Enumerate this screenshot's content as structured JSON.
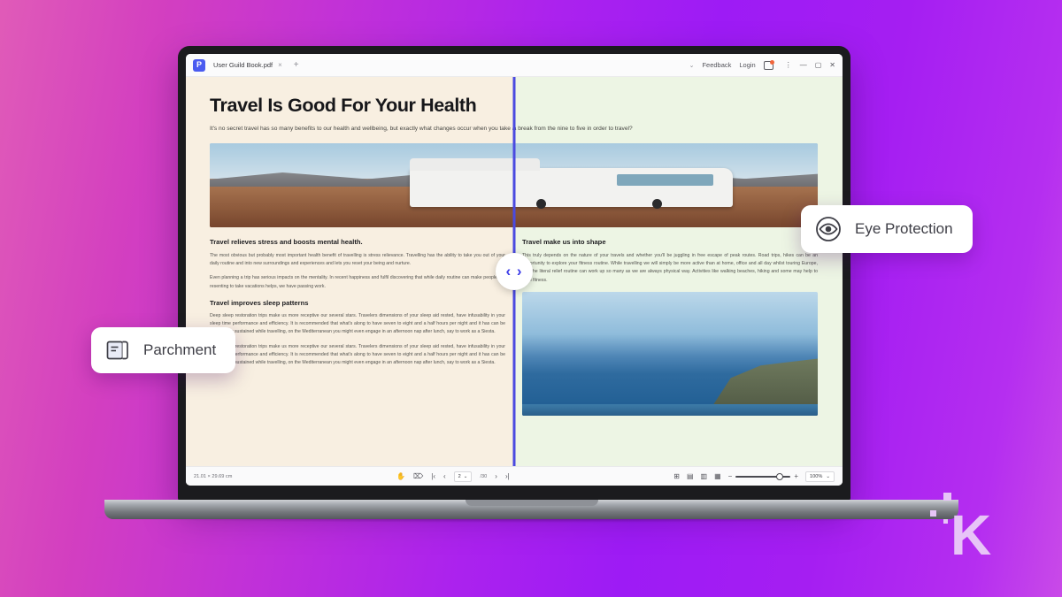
{
  "window": {
    "app_icon": "pdf-app-icon",
    "tab_title": "User Guild Book.pdf",
    "tab_close": "×",
    "new_tab": "+",
    "chevron": "⌄",
    "feedback": "Feedback",
    "login": "Login",
    "notification_icon": "notification-badge-icon",
    "menu_icon": "⋮",
    "minimize": "—",
    "maximize": "▢",
    "close": "✕"
  },
  "document": {
    "title": "Travel Is Good For Your Health",
    "lede": "It's no secret travel has so many benefits to our health and wellbeing, but exactly what changes occur when you take a break from the nine to five in order to travel?",
    "col_left_heading": "Travel relieves stress and boosts mental health.",
    "col_left_body_1": "The most obvious but probably most important health benefit of travelling is stress relievance. Travelling has the ability to take you out of your daily routine and into new surroundings and experiences and lets you reset your being and nurture.",
    "col_left_body_2": "Even planning a trip has serious impacts on the mentality. In recent happiness and fulfil discovering that while daily routine can make people still resenting to take vacations helps, we have passing work.",
    "col_right_heading": "Travel make us into shape",
    "col_right_body": "This truly depends on the nature of your travels and whether you'll be juggling in free escape of peak routes. Road trips, hikes can be an opportunity to explore your fitness routine. While travelling we will simply be more active than at home, office and all day whilst touring Europe, and the literal relief routine can work up so many as we are always physical way. Activities like walking beaches, hiking and some may help to level fitness.",
    "subheading_sleep": "Travel improves sleep patterns",
    "sleep_body": "Deep sleep restoration trips make us more receptive our several stars. Travelers dimensions of your sleep aid rested, have infusability in your sleep time performance and efficiency. It is recommended that what's along to have seven to eight and a half hours per night and it has can be more easily sustained while travelling, on the Mediterranean you might even engage in an afternoon nap after lunch, say to work as a Siesta."
  },
  "toolbar": {
    "page_dimensions": "21.01 × 29.69 cm",
    "hand_icon": "hand-tool-icon",
    "select_icon": "select-tool-icon",
    "first_page": "|‹",
    "prev_page": "‹",
    "current_page": "2",
    "page_separator": "/30",
    "next_page": "›",
    "last_page": "›|",
    "fit_page_icon": "fit-page-icon",
    "page_layout_icon": "page-layout-icon",
    "scroll_mode_icon": "scroll-mode-icon",
    "grid_view_icon": "grid-view-icon",
    "zoom_out": "−",
    "zoom_in": "+",
    "zoom_level": "100%",
    "zoom_chevron": "⌄"
  },
  "chips": [
    {
      "id": "parchment",
      "label": "Parchment",
      "icon": "parchment-scroll-icon"
    },
    {
      "id": "eye_protection",
      "label": "Eye Protection",
      "icon": "eye-icon"
    }
  ],
  "comparison": {
    "handle_icon": "‹ ›",
    "left_theme_color": "#f8efe1",
    "right_theme_color": "#edf5e4",
    "divider_color": "#4a4ae0"
  },
  "brand": {
    "letter": "K"
  },
  "colors": {
    "background_gradient_start": "#e05bb8",
    "background_gradient_end": "#c94ae8",
    "accent": "#4a4ae0"
  }
}
